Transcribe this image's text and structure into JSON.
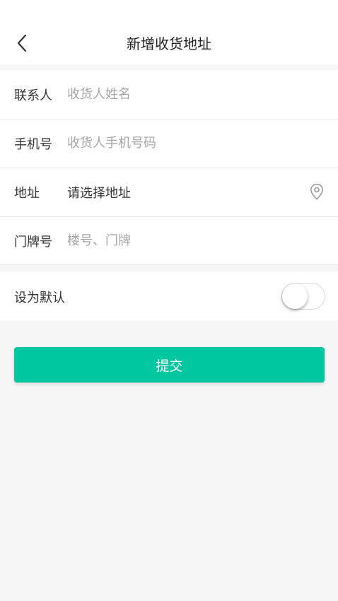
{
  "header": {
    "title": "新增收货地址",
    "back_icon": "chevron-left-icon"
  },
  "form": {
    "contact": {
      "label": "联系人",
      "placeholder": "收货人姓名",
      "value": ""
    },
    "phone": {
      "label": "手机号",
      "placeholder": "收货人手机号码",
      "value": ""
    },
    "address": {
      "label": "地址",
      "value": "请选择地址",
      "icon": "location-pin-icon"
    },
    "door": {
      "label": "门牌号",
      "placeholder": "楼号、门牌",
      "value": ""
    }
  },
  "default_setting": {
    "label": "设为默认",
    "enabled": false
  },
  "submit": {
    "label": "提交"
  },
  "colors": {
    "accent": "#00c79f",
    "background": "#f6f6f6",
    "card": "#ffffff",
    "placeholder": "#a6a6a6",
    "text": "#333333"
  }
}
